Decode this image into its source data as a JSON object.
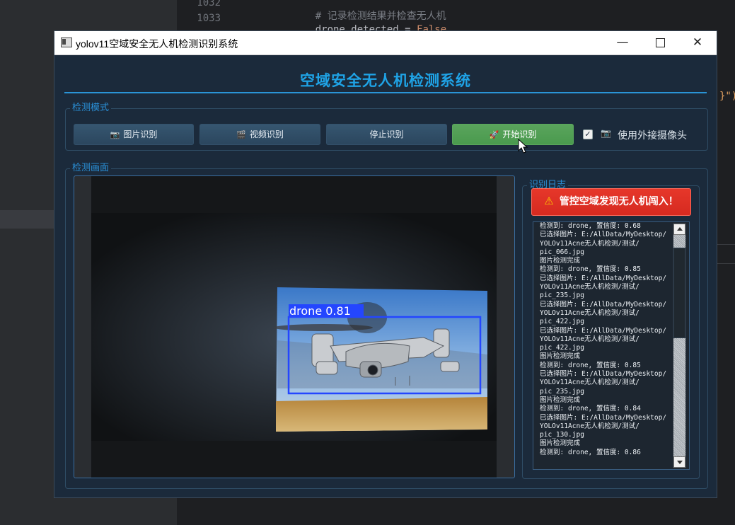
{
  "ide": {
    "line_numbers": [
      "1032",
      "1033"
    ],
    "code_lines": [
      {
        "parts": [
          {
            "cls": "comment",
            "text": "# 记录检测结果并检查无人机"
          }
        ]
      },
      {
        "parts": [
          {
            "cls": "ident",
            "text": "drone_detected = "
          },
          {
            "cls": "kw",
            "text": "False"
          }
        ]
      }
    ],
    "right_fragment": "}\")"
  },
  "window": {
    "title": "yolov11空域安全无人机检测识别系统",
    "controls": {
      "minimize": "—",
      "close": "✕"
    }
  },
  "app": {
    "heading": "空域安全无人机检测系统",
    "mode_group_title": "检测模式",
    "buttons": {
      "image": {
        "icon": "📷",
        "label": "图片识别"
      },
      "video": {
        "icon": "🎬",
        "label": "视频识别"
      },
      "stop": {
        "label": "停止识别"
      },
      "start": {
        "icon": "🚀",
        "label": "开始识别"
      }
    },
    "camera": {
      "checked": true,
      "check_mark": "✓",
      "icon": "📷",
      "label": "使用外接摄像头"
    },
    "view_group_title": "检测画面",
    "detection": {
      "label": "drone 0.81",
      "box_color": "#2446ff"
    },
    "log_group_title": "识别日志",
    "alert": {
      "icon": "⚠",
      "text": "管控空域发现无人机闯入！"
    },
    "log_lines": [
      "检测到: drone, 置信度: 0.68",
      "已选择图片: E:/AllData/MyDesktop/",
      "YOLOv11Acne无人机检测/测试/",
      "pic_066.jpg",
      "图片检测完成",
      "检测到: drone, 置信度: 0.85",
      "已选择图片: E:/AllData/MyDesktop/",
      "YOLOv11Acne无人机检测/测试/",
      "pic_235.jpg",
      "已选择图片: E:/AllData/MyDesktop/",
      "YOLOv11Acne无人机检测/测试/",
      "pic_422.jpg",
      "已选择图片: E:/AllData/MyDesktop/",
      "YOLOv11Acne无人机检测/测试/",
      "pic_422.jpg",
      "图片检测完成",
      "检测到: drone, 置信度: 0.85",
      "已选择图片: E:/AllData/MyDesktop/",
      "YOLOv11Acne无人机检测/测试/",
      "pic_235.jpg",
      "图片检测完成",
      "检测到: drone, 置信度: 0.84",
      "已选择图片: E:/AllData/MyDesktop/",
      "YOLOv11Acne无人机检测/测试/",
      "pic_130.jpg",
      "图片检测完成",
      "检测到: drone, 置信度: 0.86"
    ]
  },
  "colors": {
    "accent": "#1fa3e6",
    "window_bg": "#1b2a3b",
    "start_button": "#4a9a4e",
    "alert_bg": "#d62a20"
  }
}
